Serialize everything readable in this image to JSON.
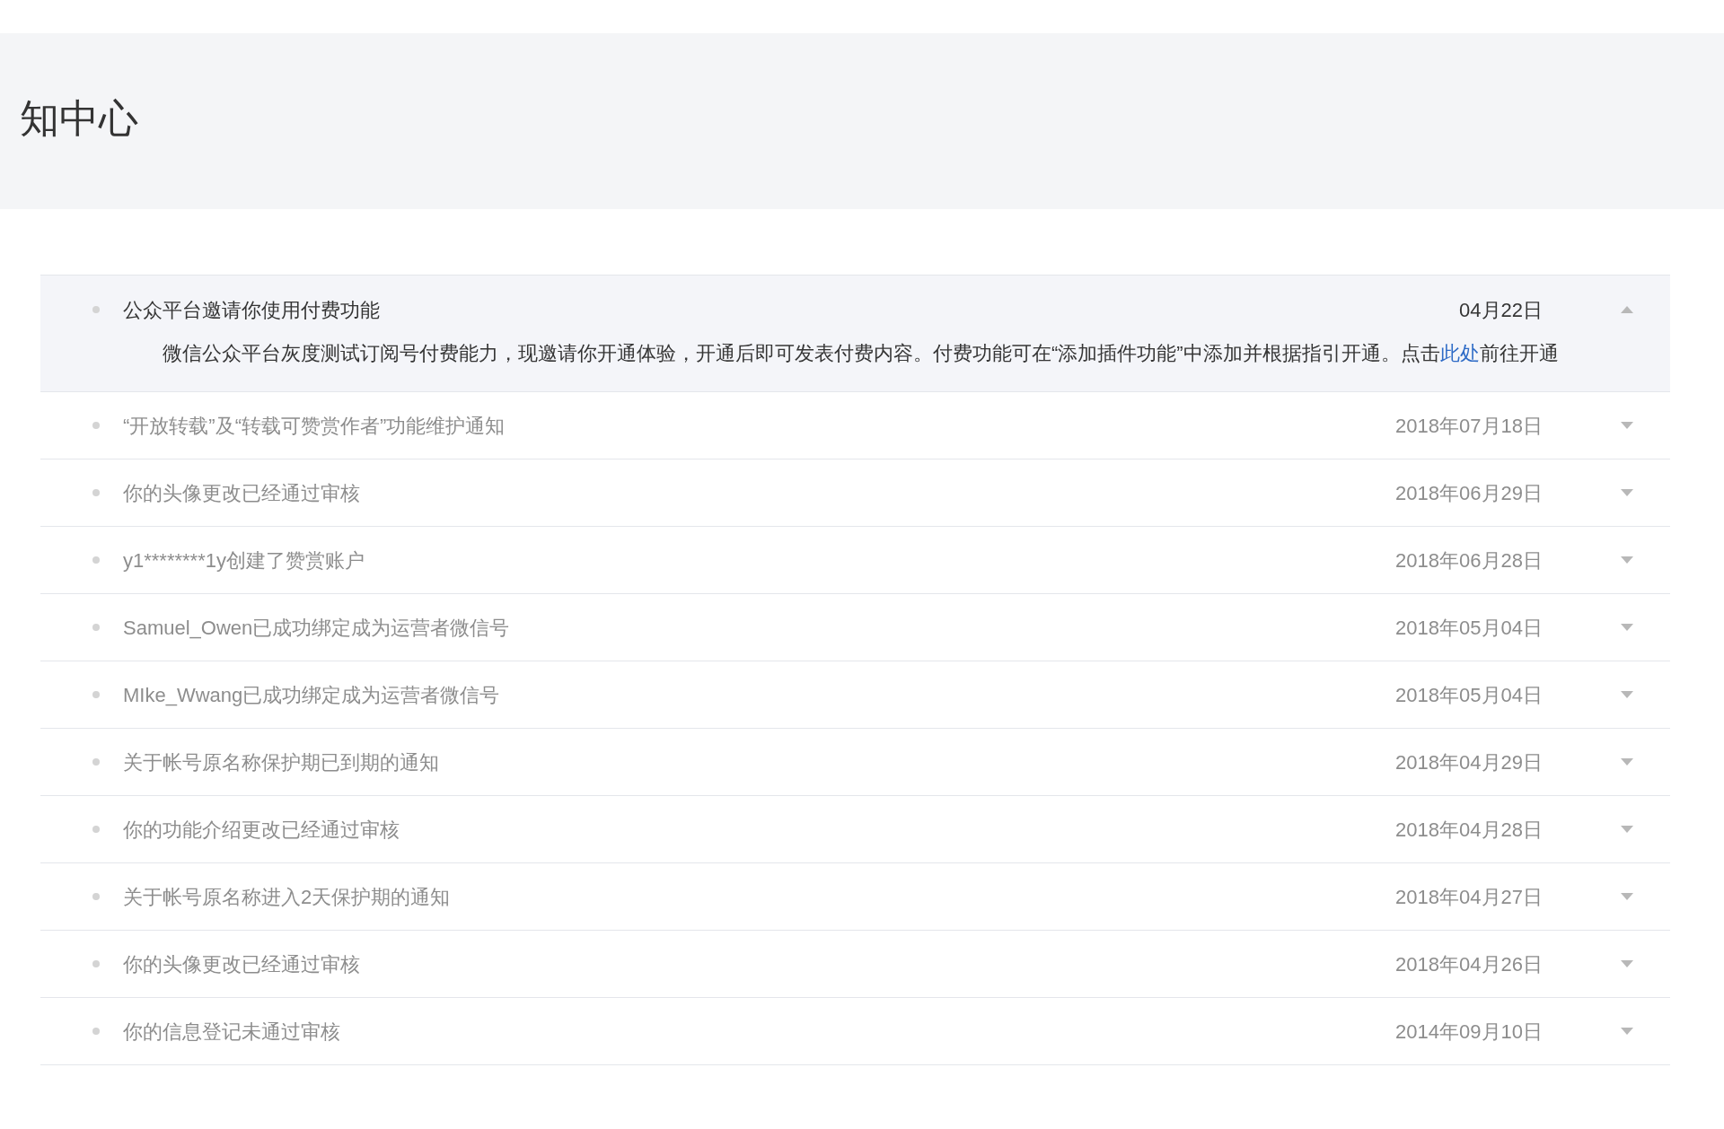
{
  "header": {
    "title": "知中心"
  },
  "notifications": [
    {
      "title": "公众平台邀请你使用付费功能",
      "date": "04月22日",
      "expanded": true,
      "body": {
        "text_before": "微信公众平台灰度测试订阅号付费能力，现邀请你开通体验，开通后即可发表付费内容。付费功能可在“添加插件功能”中添加并根据指引开通。点击",
        "link": "此处",
        "text_after": "前往开通"
      }
    },
    {
      "title": "“开放转载”及“转载可赞赏作者”功能维护通知",
      "date": "2018年07月18日",
      "expanded": false
    },
    {
      "title": "你的头像更改已经通过审核",
      "date": "2018年06月29日",
      "expanded": false
    },
    {
      "title": "y1********1y创建了赞赏账户",
      "date": "2018年06月28日",
      "expanded": false
    },
    {
      "title": "Samuel_Owen已成功绑定成为运营者微信号",
      "date": "2018年05月04日",
      "expanded": false
    },
    {
      "title": "MIke_Wwang已成功绑定成为运营者微信号",
      "date": "2018年05月04日",
      "expanded": false
    },
    {
      "title": "关于帐号原名称保护期已到期的通知",
      "date": "2018年04月29日",
      "expanded": false
    },
    {
      "title": "你的功能介绍更改已经通过审核",
      "date": "2018年04月28日",
      "expanded": false
    },
    {
      "title": "关于帐号原名称进入2天保护期的通知",
      "date": "2018年04月27日",
      "expanded": false
    },
    {
      "title": "你的头像更改已经通过审核",
      "date": "2018年04月26日",
      "expanded": false
    },
    {
      "title": "你的信息登记未通过审核",
      "date": "2014年09月10日",
      "expanded": false
    }
  ]
}
